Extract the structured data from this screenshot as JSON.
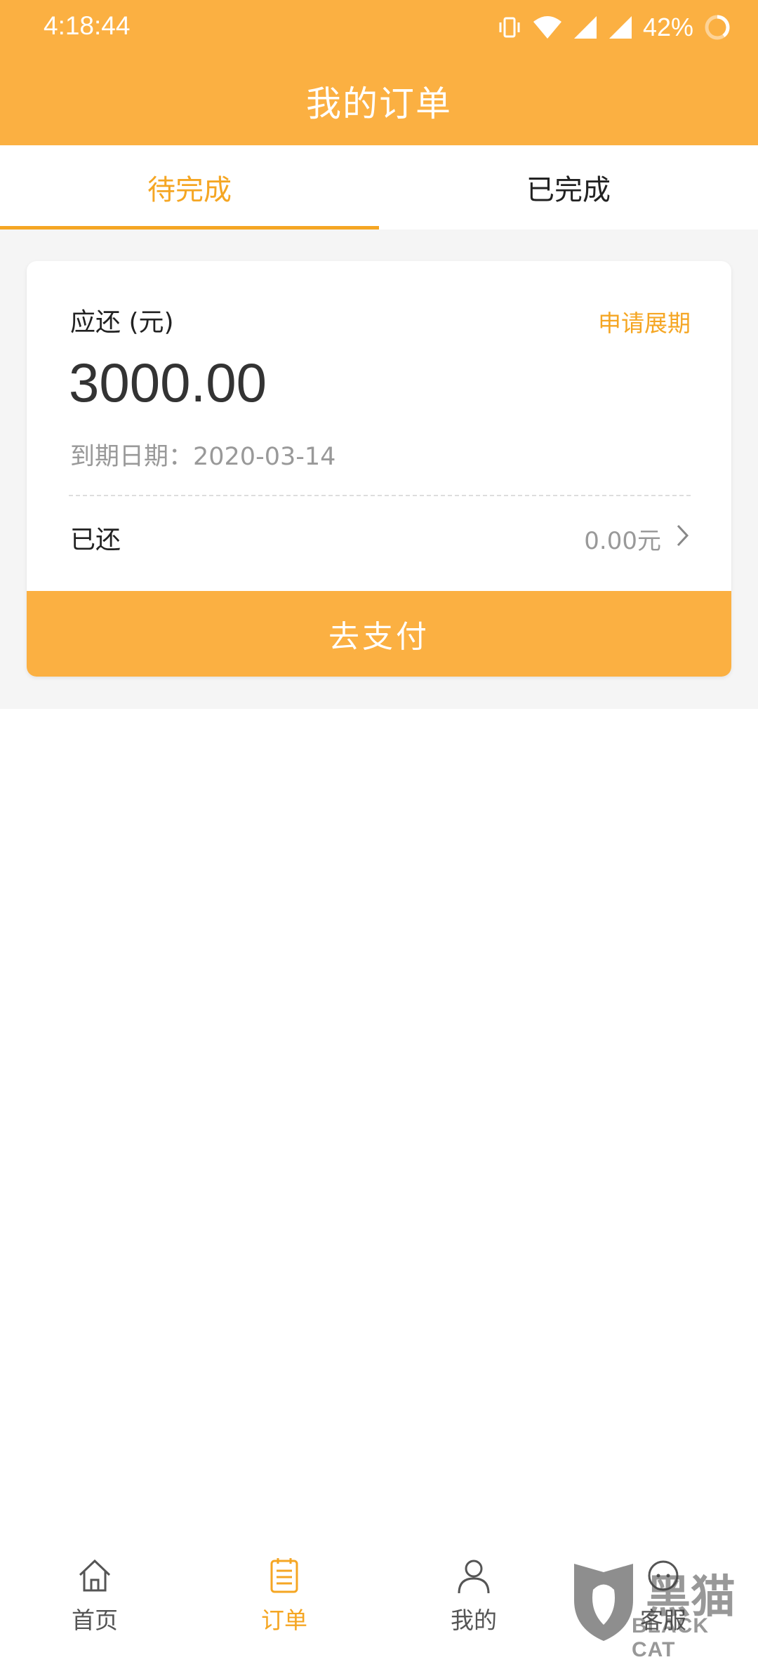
{
  "status_bar": {
    "time": "4:18:44",
    "battery": "42%"
  },
  "header": {
    "title": "我的订单"
  },
  "tabs": [
    {
      "label": "待完成",
      "active": true
    },
    {
      "label": "已完成",
      "active": false
    }
  ],
  "order": {
    "due_label": "应还 (元)",
    "extend_link": "申请展期",
    "amount": "3000.00",
    "due_date": "到期日期：2020-03-14",
    "paid_label": "已还",
    "paid_value": "0.00元",
    "pay_button": "去支付"
  },
  "bottom_nav": [
    {
      "label": "首页",
      "icon": "home-icon",
      "active": false
    },
    {
      "label": "订单",
      "icon": "order-list-icon",
      "active": true
    },
    {
      "label": "我的",
      "icon": "user-icon",
      "active": false
    },
    {
      "label": "客服",
      "icon": "customer-service-icon",
      "active": false
    }
  ],
  "watermark": {
    "text": "黑猫",
    "sub": "BLACK CAT"
  },
  "colors": {
    "accent": "#FBB042",
    "accent_text": "#F5A623"
  }
}
